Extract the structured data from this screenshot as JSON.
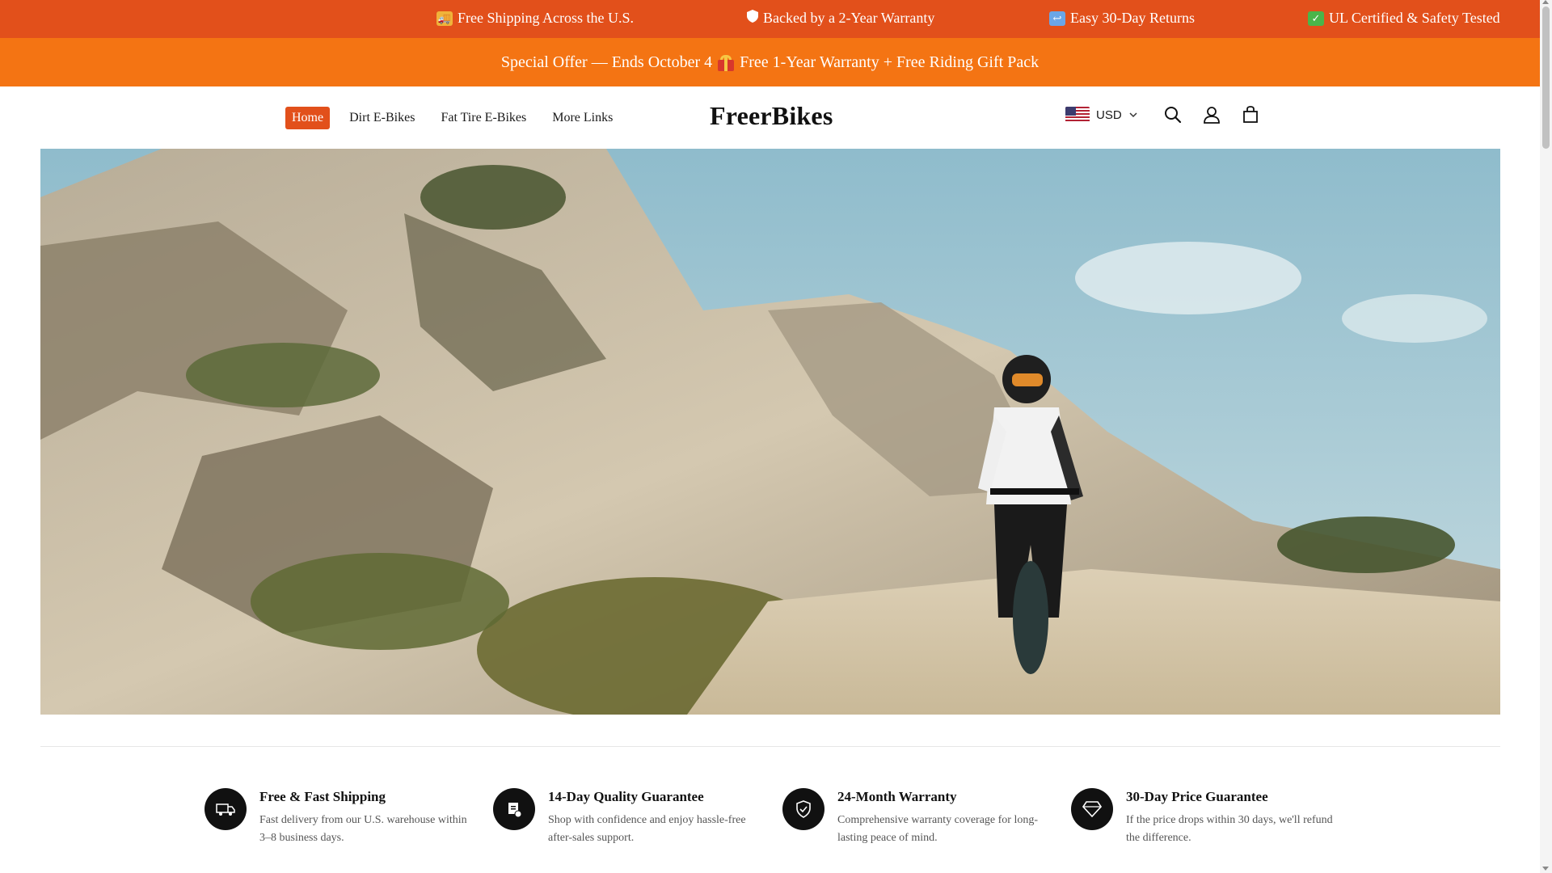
{
  "marquee": {
    "items": [
      {
        "icon": "truck-icon",
        "text": "Free Shipping Across the U.S."
      },
      {
        "icon": "shield-icon",
        "text": "Backed by a 2-Year Warranty"
      },
      {
        "icon": "return-arrow-icon",
        "text": "Easy 30-Day Returns"
      },
      {
        "icon": "check-mark-icon",
        "text": "UL Certified & Safety Tested"
      }
    ]
  },
  "offer": {
    "text_before": "Special Offer — Ends October 4",
    "text_after": "Free 1-Year Warranty + Free Riding Gift Pack",
    "icon": "gift-icon"
  },
  "nav": {
    "items": [
      {
        "label": "Home",
        "active": true
      },
      {
        "label": "Dirt E-Bikes"
      },
      {
        "label": "Fat Tire E-Bikes"
      },
      {
        "label": "More Links"
      }
    ]
  },
  "brand": {
    "logo": "FreerBikes"
  },
  "currency": {
    "code": "USD",
    "flag": "us-flag-icon"
  },
  "colors": {
    "marquee_bg": "#e2501b",
    "offer_bg": "#f47413",
    "accent": "#e2501b"
  },
  "features": [
    {
      "icon": "delivery-truck-icon",
      "title": "Free & Fast Shipping",
      "desc": "Fast delivery from our U.S. warehouse within 3–8 business days."
    },
    {
      "icon": "quality-badge-icon",
      "title": "14-Day Quality Guarantee",
      "desc": "Shop with confidence and enjoy hassle-free after-sales support."
    },
    {
      "icon": "shield-check-icon",
      "title": "24-Month Warranty",
      "desc": "Comprehensive warranty coverage for long-lasting peace of mind."
    },
    {
      "icon": "diamond-30-icon",
      "title": "30-Day Price Guarantee",
      "desc": "If the price drops within 30 days, we'll refund the difference."
    }
  ]
}
